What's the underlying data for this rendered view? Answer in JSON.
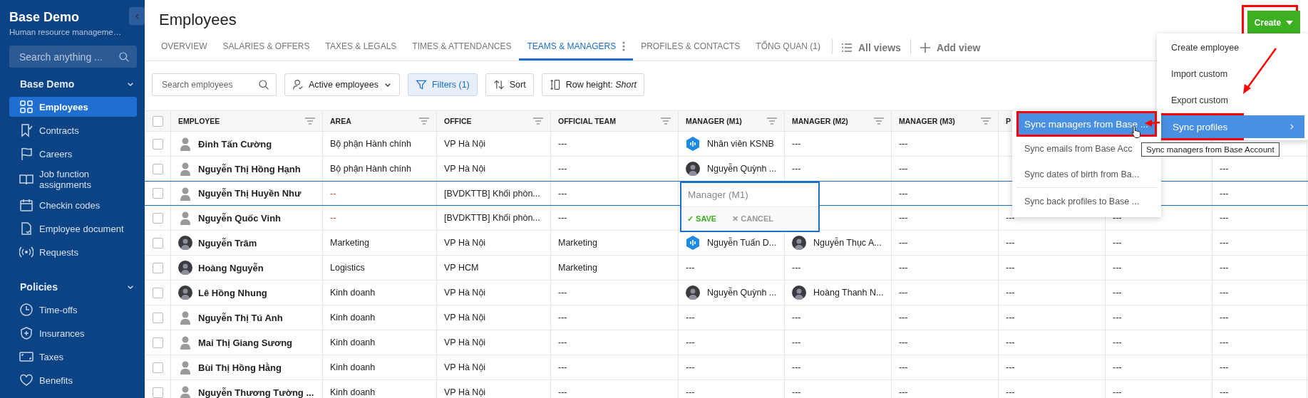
{
  "sidebar": {
    "title": "Base Demo",
    "subtitle": "Human resource manageme…",
    "search": {
      "placeholder": "Search anything ..."
    },
    "sections": [
      {
        "title": "Base Demo",
        "expanded": true,
        "items": [
          {
            "label": "Employees",
            "selected": true
          },
          {
            "label": "Contracts",
            "selected": false
          },
          {
            "label": "Careers",
            "selected": false
          },
          {
            "label": "Job function assignments",
            "selected": false
          },
          {
            "label": "Checkin codes",
            "selected": false
          },
          {
            "label": "Employee document",
            "selected": false
          },
          {
            "label": "Requests",
            "selected": false
          }
        ]
      },
      {
        "title": "Policies",
        "expanded": true,
        "items": [
          {
            "label": "Time-offs",
            "selected": false
          },
          {
            "label": "Insurances",
            "selected": false
          },
          {
            "label": "Taxes",
            "selected": false
          },
          {
            "label": "Benefits",
            "selected": false
          }
        ]
      }
    ]
  },
  "page_title": "Employees",
  "create_button": {
    "label": "Create",
    "annotated": true
  },
  "tabs": [
    {
      "label": "OVERVIEW",
      "selected": false
    },
    {
      "label": "SALARIES & OFFERS",
      "selected": false
    },
    {
      "label": "TAXES & LEGALS",
      "selected": false
    },
    {
      "label": "TIMES & ATTENDANCES",
      "selected": false
    },
    {
      "label": "TEAMS & MANAGERS",
      "selected": true
    },
    {
      "label": "PROFILES & CONTACTS",
      "selected": false
    },
    {
      "label": "TỔNG QUAN (1)",
      "selected": false
    }
  ],
  "views_menu": {
    "label": "All views"
  },
  "add_view": {
    "label": "Add view"
  },
  "toolbar": {
    "search": {
      "placeholder": "Search employees"
    },
    "status_filter": {
      "label": "Active employees"
    },
    "filters": {
      "label": "Filters (1)",
      "active": true
    },
    "sort": {
      "label": "Sort"
    },
    "row_height": {
      "label": "Row height: *Short*"
    }
  },
  "table": {
    "all_checked": false,
    "columns": [
      {
        "label": "EMPLOYEE",
        "filter": true
      },
      {
        "label": "AREA",
        "filter": true
      },
      {
        "label": "OFFICE",
        "filter": true
      },
      {
        "label": "OFFICIAL TEAM",
        "filter": true
      },
      {
        "label": "MANAGER (M1)",
        "filter": true
      },
      {
        "label": "MANAGER (M2)",
        "filter": true
      },
      {
        "label": "MANAGER (M3)",
        "filter": true
      },
      {
        "label": "P",
        "filter": false
      }
    ],
    "rows": [
      {
        "selected": false,
        "checked": false,
        "cells": {
          "employee": {
            "text": "Đinh Tấn Cường",
            "kind": "placeholder"
          },
          "area": "Bộ phận Hành chính",
          "office": "VP Hà Nội",
          "official_team": "---",
          "manager_m1": {
            "text": "Nhân viên KSNB",
            "kind": "logo"
          },
          "manager_m2": "---",
          "manager_m3": "---"
        }
      },
      {
        "selected": false,
        "checked": false,
        "cells": {
          "employee": {
            "text": "Nguyễn Thị Hồng Hạnh",
            "kind": "placeholder"
          },
          "area": "Bộ phận Hành chính",
          "office": "VP Hà Nội",
          "official_team": "---",
          "manager_m1": {
            "text": "Nguyễn Quỳnh ...",
            "kind": "photo"
          },
          "manager_m2": "---",
          "manager_m3": "---",
          "column_11": "---"
        }
      },
      {
        "selected": true,
        "checked": false,
        "cells": {
          "employee": {
            "text": "Nguyễn Thị Huyền Như",
            "kind": "placeholder"
          },
          "area": {
            "text": "--",
            "kind": "missing"
          },
          "office": "[BVDKTTB] Khối phòn...",
          "official_team": "---",
          "manager_m3": "---",
          "column_11": "---"
        }
      },
      {
        "selected": false,
        "checked": false,
        "cells": {
          "employee": {
            "text": "Nguyễn Quốc Vinh",
            "kind": "placeholder"
          },
          "area": {
            "text": "--",
            "kind": "missing"
          },
          "office": "[BVDKTTB] Khối phòn...",
          "official_team": "---",
          "manager_m3": "---",
          "column_9": "---",
          "column_10": "---",
          "column_11": "---"
        }
      },
      {
        "selected": false,
        "checked": false,
        "cells": {
          "employee": {
            "text": "Nguyễn Trâm",
            "kind": "photo"
          },
          "area": "Marketing",
          "office": "VP Hà Nội",
          "official_team": "Marketing",
          "manager_m1": {
            "text": "Nguyễn Tuấn D...",
            "kind": "logo"
          },
          "manager_m2": {
            "text": "Nguyễn Thục A...",
            "kind": "photo"
          },
          "manager_m3": "---",
          "column_9": "---",
          "column_10": "---",
          "column_11": "---"
        }
      },
      {
        "selected": false,
        "checked": false,
        "cells": {
          "employee": {
            "text": "Hoàng Nguyễn",
            "kind": "photo"
          },
          "area": "Logistics",
          "office": "VP HCM",
          "official_team": "Marketing",
          "manager_m1": "---",
          "manager_m2": "---",
          "manager_m3": "---",
          "column_9": "---",
          "column_10": "---",
          "column_11": "---"
        }
      },
      {
        "selected": false,
        "checked": false,
        "cells": {
          "employee": {
            "text": "Lê Hồng Nhung",
            "kind": "photo"
          },
          "area": "Kinh doanh",
          "office": "VP Hà Nội",
          "official_team": "---",
          "manager_m1": {
            "text": "Nguyễn Quỳnh ...",
            "kind": "photo"
          },
          "manager_m2": {
            "text": "Hoàng Thanh N...",
            "kind": "photo"
          },
          "manager_m3": "---",
          "column_9": "---",
          "column_10": "---",
          "column_11": "---"
        }
      },
      {
        "selected": false,
        "checked": false,
        "cells": {
          "employee": {
            "text": "Nguyễn Thị Tú Anh",
            "kind": "placeholder"
          },
          "area": "Kinh doanh",
          "office": "VP Hà Nội",
          "official_team": "---",
          "manager_m1": "---",
          "manager_m2": "---",
          "manager_m3": "---",
          "column_9": "---",
          "column_10": "---",
          "column_11": "---"
        }
      },
      {
        "selected": false,
        "checked": false,
        "cells": {
          "employee": {
            "text": "Mai Thị Giang Sương",
            "kind": "placeholder"
          },
          "area": "Kinh doanh",
          "office": "VP Hà Nội",
          "official_team": "---",
          "manager_m1": "---",
          "manager_m2": "---",
          "manager_m3": "---",
          "column_9": "---",
          "column_10": "---",
          "column_11": "---"
        }
      },
      {
        "selected": false,
        "checked": false,
        "cells": {
          "employee": {
            "text": "Bùi Thị Hồng Hằng",
            "kind": "placeholder"
          },
          "area": "Kinh doanh",
          "office": "VP Hà Nội",
          "official_team": "---",
          "manager_m1": "---",
          "manager_m2": "---",
          "manager_m3": "---",
          "column_9": "---",
          "column_10": "---",
          "column_11": "---"
        }
      },
      {
        "selected": false,
        "checked": false,
        "cells": {
          "employee": {
            "text": "Nguyễn Thương Tường ...",
            "kind": "placeholder"
          },
          "area": "Kinh doanh",
          "office": "VP Hà Nội",
          "official_team": "---",
          "manager_m1": "---",
          "manager_m2": "---",
          "manager_m3": "---",
          "column_9": "---",
          "column_10": "---",
          "column_11": "---"
        }
      }
    ]
  },
  "cell_editor": {
    "placeholder": "Manager (M1)",
    "actions": [
      {
        "kind": "save",
        "label": "✓ SAVE"
      },
      {
        "kind": "cancel",
        "label": "✕ CANCEL"
      }
    ]
  },
  "create_menu": {
    "items": [
      {
        "label": "Create employee",
        "selected": false,
        "annotated": false
      },
      {
        "label": "Import custom",
        "selected": false,
        "annotated": false
      },
      {
        "label": "Export custom",
        "selected": false,
        "annotated": false
      },
      {
        "label": "Sync profiles",
        "selected": true,
        "submenu": true,
        "annotated": true
      }
    ]
  },
  "sync_submenu": {
    "items": [
      {
        "label": "Sync managers from Base ...",
        "selected": true,
        "annotated": true
      },
      {
        "label": "Sync emails from Base Acc",
        "selected": false,
        "annotated": false
      },
      {
        "label": "Sync dates of birth from Ba...",
        "selected": false,
        "annotated": false
      },
      {
        "label": "Sync back profiles to Base ...",
        "selected": false,
        "annotated": false,
        "divider_before": true
      }
    ]
  },
  "tooltip": {
    "text": "Sync managers from Base Account"
  }
}
